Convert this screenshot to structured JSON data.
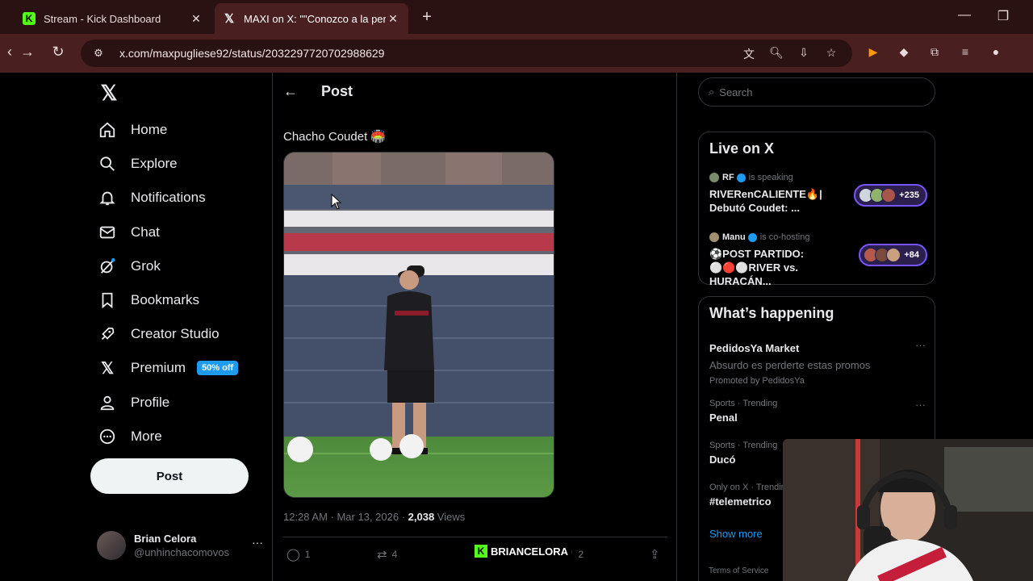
{
  "browser": {
    "tabs": [
      {
        "title": "Stream - Kick Dashboard",
        "active": false,
        "favicon": "kick-icon"
      },
      {
        "title": "MAXI on X: \"\"Conozco a la perf",
        "active": true,
        "favicon": "x-logo-icon"
      }
    ],
    "new_tab_icon": "+",
    "url": "x.com/maxpugliese92/status/2032297720702988629"
  },
  "sidebar": {
    "logo": "𝕏",
    "items": [
      {
        "label": "Home",
        "icon": "home-icon"
      },
      {
        "label": "Explore",
        "icon": "search-icon"
      },
      {
        "label": "Notifications",
        "icon": "bell-icon"
      },
      {
        "label": "Chat",
        "icon": "mail-icon"
      },
      {
        "label": "Grok",
        "icon": "grok-icon"
      },
      {
        "label": "Bookmarks",
        "icon": "bookmark-icon"
      },
      {
        "label": "Creator Studio",
        "icon": "rocket-icon"
      },
      {
        "label": "Premium",
        "icon": "x-logo-icon",
        "badge": "50% off"
      },
      {
        "label": "Profile",
        "icon": "person-icon"
      },
      {
        "label": "More",
        "icon": "more-circle-icon"
      }
    ],
    "post_button": "Post",
    "account": {
      "name": "Brian Celora",
      "handle": "@unhinchacomovos"
    }
  },
  "post": {
    "header_title": "Post",
    "text": "Chacho Coudet 🏟️",
    "timestamp": "12:28 AM · Mar 13, 2026 · ",
    "views_count": "2,038",
    "views_label": " Views",
    "actions": {
      "replies": "1",
      "reposts": "4",
      "likes": "2"
    }
  },
  "right": {
    "search_placeholder": "Search",
    "live": {
      "title": "Live on X",
      "items": [
        {
          "host": "RF",
          "status": "is speaking",
          "title": "RIVERenCALIENTE🔥| Debutó Coudet: ...",
          "count": "+235"
        },
        {
          "host": "Manu",
          "status": "is co-hosting",
          "title": "⚽POST PARTIDO: ⚪🔴⚪RIVER vs. HURACÁN...",
          "count": "+84"
        }
      ]
    },
    "trends": {
      "title": "What’s happening",
      "items": [
        {
          "context": "",
          "name": "PedidosYa Market",
          "sub": "Absurdo es perderte estas promos",
          "promo": "Promoted by PedidosYa"
        },
        {
          "context": "Sports · Trending",
          "name": "Penal"
        },
        {
          "context": "Sports · Trending",
          "name": "Ducó"
        },
        {
          "context": "Only on X · Trending",
          "name": "#telemetrico"
        }
      ],
      "show_more": "Show more"
    },
    "footer": "Terms of Service"
  },
  "overlay": {
    "streamer": "BRIANCELORA"
  },
  "colors": {
    "accent": "#1d9bf0",
    "kick": "#53fc18",
    "tab_bg": "#2b1212",
    "toolbar_bg": "#4a1f1f"
  }
}
